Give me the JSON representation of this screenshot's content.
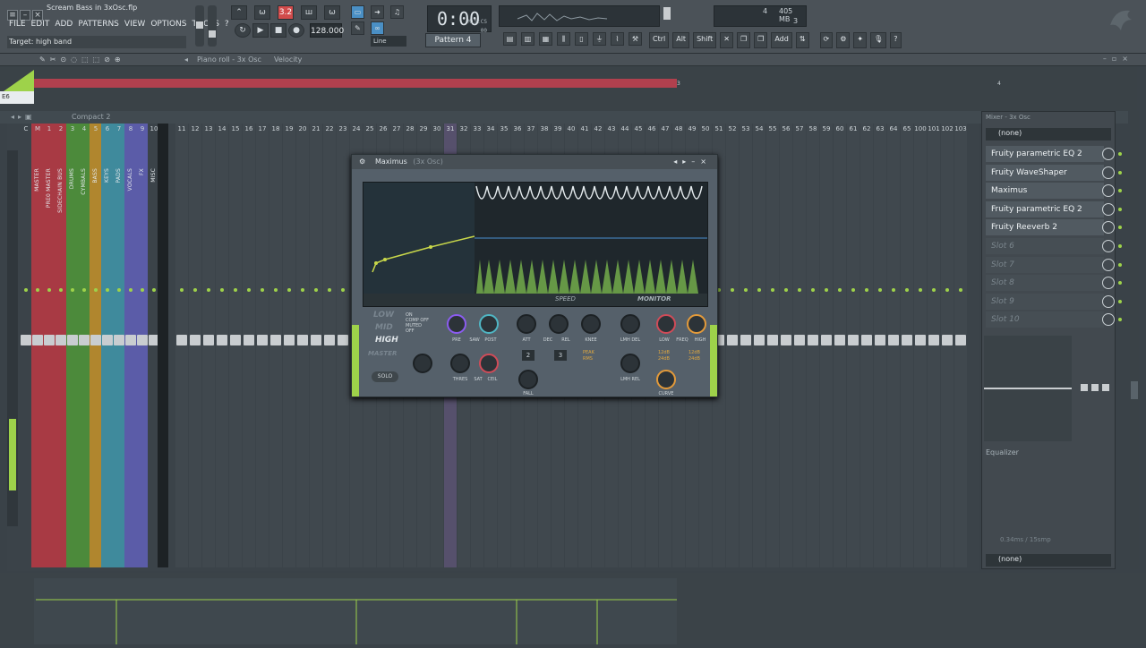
{
  "window": {
    "filename": "Scream Bass in 3xOsc.flp",
    "hint": "Target: high band"
  },
  "menu": [
    "FILE",
    "EDIT",
    "ADD",
    "PATTERNS",
    "VIEW",
    "OPTIONS",
    "TOOLS",
    "?"
  ],
  "transport": {
    "tempo": "128.000",
    "time": "0:00",
    "time_sub": "00",
    "time_unit": "M:S:CS",
    "pattern": "Pattern 4",
    "snap": "Line",
    "cpu_a": "4",
    "mem": "405 MB",
    "cpu_b": "3"
  },
  "toolbar": {
    "ctrl": "Ctrl",
    "alt": "Alt",
    "shift": "Shift",
    "add": "Add"
  },
  "pianoroll": {
    "title": "Piano roll - 3x Osc",
    "param": "Velocity",
    "bar1": "1",
    "bar2": "2",
    "bar3": "3",
    "bar4": "4",
    "note": "E6"
  },
  "mixer": {
    "title": "Compact 2",
    "tracks": [
      {
        "num": "C",
        "name": ""
      },
      {
        "num": "M",
        "name": "MASTER"
      },
      {
        "num": "1",
        "name": "PRE0 MASTER"
      },
      {
        "num": "2",
        "name": "SIDECHAIN BUS"
      },
      {
        "num": "3",
        "name": "DRUMS"
      },
      {
        "num": "4",
        "name": "CYMBALS"
      },
      {
        "num": "5",
        "name": "BASS"
      },
      {
        "num": "6",
        "name": "KEYS"
      },
      {
        "num": "7",
        "name": "PADS"
      },
      {
        "num": "8",
        "name": "VOCALS"
      },
      {
        "num": "9",
        "name": "FX"
      },
      {
        "num": "10",
        "name": "MISC"
      }
    ],
    "insert_nums": [
      "11",
      "12",
      "13",
      "14",
      "15",
      "16",
      "17",
      "18",
      "19",
      "20",
      "21",
      "22",
      "23",
      "24",
      "25",
      "26",
      "27",
      "28",
      "29",
      "30",
      "31",
      "32",
      "33",
      "34",
      "35",
      "36",
      "37",
      "38",
      "39",
      "40",
      "41",
      "42",
      "43",
      "44",
      "45",
      "46",
      "47",
      "48",
      "49",
      "50",
      "51",
      "52",
      "53",
      "54",
      "55",
      "56",
      "57",
      "58",
      "59",
      "60",
      "61",
      "62",
      "63",
      "64",
      "65",
      "100",
      "101",
      "102",
      "103"
    ]
  },
  "plugin": {
    "title": "Maximus",
    "subtitle": "(3x Osc)",
    "bands": [
      "LOW",
      "MID",
      "HIGH",
      "MASTER"
    ],
    "modes": [
      "ON",
      "COMP OFF",
      "MUTED",
      "OFF"
    ],
    "solo": "SOLO",
    "speed": "SPEED",
    "monitor": "MONITOR",
    "knob_labels": [
      "PRE",
      "SAW",
      "POST",
      "ATT",
      "DEC",
      "REL",
      "KNEE",
      "LMH DEL",
      "LOW",
      "FREQ",
      "HIGH",
      "THRES",
      "SAT",
      "CEIL",
      "FALL",
      "LMH REL",
      "CURVE"
    ],
    "lh_values": [
      "2",
      "3"
    ],
    "peak": "PEAK",
    "rms": "RMS",
    "db1": "12dB",
    "db2": "24dB",
    "db3": "12dB",
    "db4": "24dB"
  },
  "rpanel": {
    "title": "Mixer - 3x Osc",
    "input": "(none)",
    "slots": [
      "Fruity parametric EQ 2",
      "Fruity WaveShaper",
      "Maximus",
      "Fruity parametric EQ 2",
      "Fruity Reeverb 2",
      "Slot 6",
      "Slot 7",
      "Slot 8",
      "Slot 9",
      "Slot 10"
    ],
    "eq_label": "Equalizer",
    "latency": "0.34ms / 15smp",
    "output": "(none)"
  },
  "colors": {
    "accent_green": "#9ed24a",
    "red_bar": "#b1404e",
    "tempo_red": "#d14b4b"
  }
}
